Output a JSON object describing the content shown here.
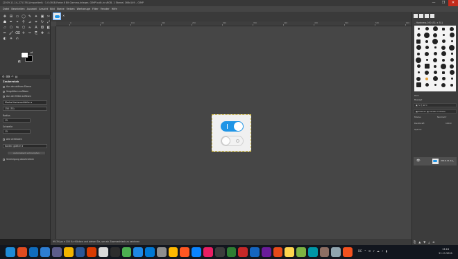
{
  "window": {
    "title": "[2019-11-14_271176] (importiert) · 1.0 (RGB-Farbe 8 Bit Gamma-Integer, GIMP built-in sRGB, 1 Ebene) 166x149 – GIMP",
    "controls": [
      "—",
      "❐",
      "✕"
    ]
  },
  "menubar": {
    "items": [
      "Datei",
      "Bearbeiten",
      "Auswahl",
      "Ansicht",
      "Bild",
      "Ebene",
      "Farben",
      "Werkzeuge",
      "Filter",
      "Fenster",
      "Hilfe"
    ]
  },
  "toolbox": {
    "tools": [
      {
        "name": "move-tool-icon",
        "glyph": "✥"
      },
      {
        "name": "align-tool-icon",
        "glyph": "⊞"
      },
      {
        "name": "rect-select-icon",
        "glyph": "▭"
      },
      {
        "name": "ellipse-select-icon",
        "glyph": "◯"
      },
      {
        "name": "free-select-icon",
        "glyph": "✎"
      },
      {
        "name": "fuzzy-select-icon",
        "glyph": "✦"
      },
      {
        "name": "color-select-icon",
        "glyph": "▣"
      },
      {
        "name": "scissors-icon",
        "glyph": "✂"
      },
      {
        "name": "foreground-select-icon",
        "glyph": "☗"
      },
      {
        "name": "paths-icon",
        "glyph": "✒"
      },
      {
        "name": "color-picker-icon",
        "glyph": "⌖"
      },
      {
        "name": "zoom-icon",
        "glyph": "⚲"
      },
      {
        "name": "measure-icon",
        "glyph": "⊿"
      },
      {
        "name": "crop-icon",
        "glyph": "⌗"
      },
      {
        "name": "rotate-icon",
        "glyph": "↻"
      },
      {
        "name": "scale-icon",
        "glyph": "⤢"
      },
      {
        "name": "shear-icon",
        "glyph": "▱"
      },
      {
        "name": "perspective-icon",
        "glyph": "⬠"
      },
      {
        "name": "flip-icon",
        "glyph": "⇋"
      },
      {
        "name": "cage-icon",
        "glyph": "⬡"
      },
      {
        "name": "warp-icon",
        "glyph": "≈"
      },
      {
        "name": "text-icon",
        "glyph": "A"
      },
      {
        "name": "bucket-fill-icon",
        "glyph": "⛾"
      },
      {
        "name": "blend-icon",
        "glyph": "◧"
      },
      {
        "name": "pencil-icon",
        "glyph": "✏"
      },
      {
        "name": "paintbrush-icon",
        "glyph": "🖌"
      },
      {
        "name": "eraser-icon",
        "glyph": "⌫"
      },
      {
        "name": "airbrush-icon",
        "glyph": "✈"
      },
      {
        "name": "ink-icon",
        "glyph": "✑"
      },
      {
        "name": "clone-icon",
        "glyph": "⎘"
      },
      {
        "name": "heal-icon",
        "glyph": "✚"
      },
      {
        "name": "smudge-icon",
        "glyph": "☝"
      },
      {
        "name": "dodge-burn-icon",
        "glyph": "◐"
      },
      {
        "name": "blur-icon",
        "glyph": "☀"
      },
      {
        "name": "mypaint-brush-icon",
        "glyph": "✍"
      }
    ],
    "options": {
      "title": "Zauberstab",
      "modes": [
        "Aus der aktiven Ebene",
        "Vergrößern auflösen",
        "Aus der Mitte auflösen"
      ],
      "field1_label": "Modus",
      "field1_value": "Kantenschärfen",
      "field2_value": "150 (70)",
      "label_radius": "Radius",
      "radius_value": "15",
      "label_schwelle": "Schwelle",
      "schwelle_value": "15",
      "check_antialias": "Alle vertikalen",
      "select_label": "Kanten glätten",
      "btn_auto": "Automatisch schrumpfen",
      "check_merge": "Vereinigung abschneiden"
    }
  },
  "canvas": {
    "tab_close": "✕",
    "ruler_marks": [
      "0",
      "100",
      "150",
      "200",
      "250",
      "300",
      "350",
      "400",
      "450",
      "500",
      "550",
      "600"
    ],
    "toggle_on_color": "#1f95e6",
    "image_bg": "#f0f0f0"
  },
  "statusbar": {
    "text": "99.3%   px ▾   100 % ▾   Klicken und ziehen Sie, um ein Zoomrechteck zu zeichnen"
  },
  "right_dock": {
    "brush_label": "– Hardness 050 (51 × 51)",
    "brush_values": [
      "Rain",
      "Bewegt",
      "Modus",
      "Deckkraft"
    ],
    "mode_label": "Modus",
    "mode_value": "Normal ▾",
    "opacity_label": "Deckkraft",
    "opacity_value": "100.0",
    "lock_label": "Sperre:",
    "layer_name": "2019-11-14_",
    "bottom_icons": [
      "⎘",
      "▲",
      "▼",
      "⤓",
      "⊗"
    ]
  },
  "taskbar": {
    "app_colors": [
      "#1e8ad6",
      "#e04b1f",
      "#0f6cbd",
      "#2d7dd2",
      "#5c5c8a",
      "#f2b400",
      "#2b5797",
      "#d83b01",
      "#d9d9d9",
      "#2d2d2d",
      "#4caf50",
      "#1e88e5",
      "#0078d4",
      "#8e8e8e",
      "#ffb900",
      "#ff5722",
      "#0a84ff",
      "#e91e63",
      "#3c3c3c",
      "#2e7d32",
      "#c62828",
      "#1565c0",
      "#6a1b9a",
      "#e64a19",
      "#ffd54f",
      "#7cb342",
      "#0097a7",
      "#8d6e63",
      "#90a4ae",
      "#f4511e"
    ],
    "tray": [
      "DE",
      "⌃",
      "✉",
      "♪",
      "☁",
      "⚡",
      "▮"
    ],
    "time": "13:18",
    "date": "21.11.2019"
  }
}
